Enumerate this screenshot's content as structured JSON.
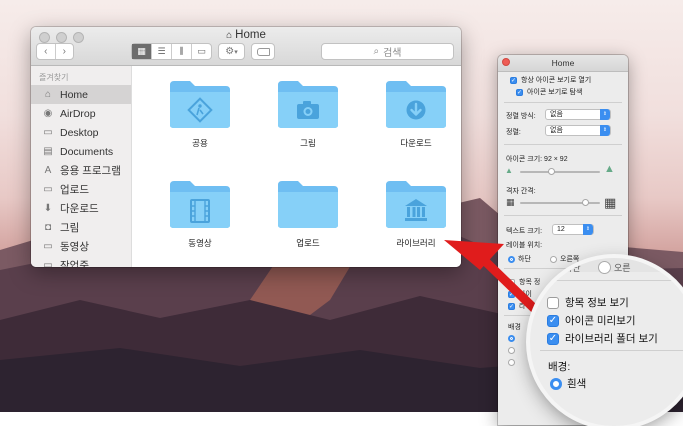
{
  "finder": {
    "title": "Home",
    "search_placeholder": "검색",
    "sidebar_heading": "즐겨찾기",
    "sidebar_items": [
      {
        "label": "Home",
        "icon": "home-icon"
      },
      {
        "label": "AirDrop",
        "icon": "airdrop-icon"
      },
      {
        "label": "Desktop",
        "icon": "desktop-icon"
      },
      {
        "label": "Documents",
        "icon": "documents-icon"
      },
      {
        "label": "응용 프로그램",
        "icon": "applications-icon"
      },
      {
        "label": "업로드",
        "icon": "folder-icon"
      },
      {
        "label": "다운로드",
        "icon": "download-icon"
      },
      {
        "label": "그림",
        "icon": "camera-icon"
      },
      {
        "label": "동영상",
        "icon": "folder-icon"
      },
      {
        "label": "작업중",
        "icon": "folder-icon"
      }
    ],
    "folders": [
      {
        "label": "공용",
        "badge": "public"
      },
      {
        "label": "그림",
        "badge": "camera"
      },
      {
        "label": "다운로드",
        "badge": "download"
      },
      {
        "label": "동영상",
        "badge": "film"
      },
      {
        "label": "업로드",
        "badge": "none"
      },
      {
        "label": "라이브러리",
        "badge": "library"
      }
    ]
  },
  "view_options": {
    "title": "Home",
    "always_open_icon_view": "항상 아이콘 보기로 열기",
    "browse_icon_view": "아이콘 보기로 탐색",
    "arrange_by_label": "정렬 방식:",
    "arrange_by_value": "없음",
    "sort_by_label": "정렬:",
    "sort_by_value": "없음",
    "icon_size_label": "아이콘 크기:",
    "icon_size_value": "92 × 92",
    "grid_spacing_label": "격자 간격:",
    "text_size_label": "텍스트 크기:",
    "text_size_value": "12",
    "label_position_label": "레이블 위치:",
    "label_bottom": "하단",
    "label_right": "오른쪽",
    "show_item_info_short": "항목 정",
    "show_icon_preview_short": "아이",
    "show_library_short": "라이",
    "background_short": "배경"
  },
  "magnifier": {
    "partial_top_left": "하단",
    "partial_top_right": "오른",
    "show_item_info": "항목 정보 보기",
    "show_icon_preview": "아이콘 미리보기",
    "show_library_folder": "라이브러리 폴더 보기",
    "background_label": "배경:",
    "background_white": "흰색",
    "checks": {
      "show_item_info": false,
      "show_icon_preview": true,
      "show_library_folder": true
    }
  },
  "colors": {
    "accent": "#3b8ef0",
    "folder": "#7cc7f4",
    "arrow": "#e01c1c"
  }
}
